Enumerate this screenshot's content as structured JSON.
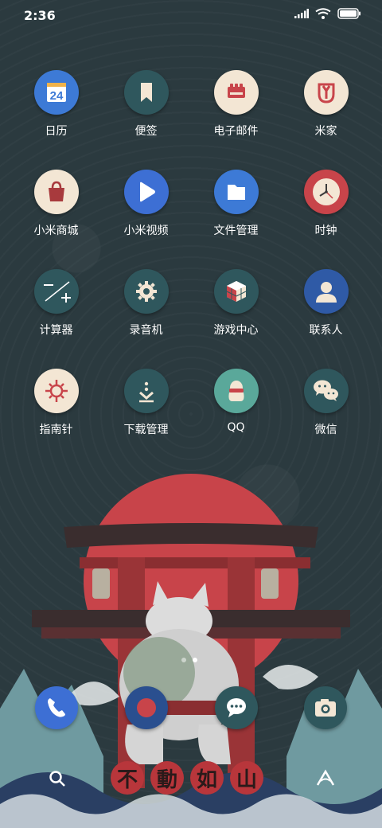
{
  "status_bar": {
    "time": "2:36"
  },
  "apps": [
    {
      "label": "日历",
      "icon": "calendar-icon",
      "badge_text": "24"
    },
    {
      "label": "便签",
      "icon": "bookmark-icon"
    },
    {
      "label": "电子邮件",
      "icon": "mail-icon"
    },
    {
      "label": "米家",
      "icon": "mijia-icon"
    },
    {
      "label": "小米商城",
      "icon": "shopping-bag-icon"
    },
    {
      "label": "小米视频",
      "icon": "video-play-icon"
    },
    {
      "label": "文件管理",
      "icon": "folder-icon"
    },
    {
      "label": "时钟",
      "icon": "clock-icon"
    },
    {
      "label": "计算器",
      "icon": "calculator-icon"
    },
    {
      "label": "录音机",
      "icon": "recorder-gear-icon"
    },
    {
      "label": "游戏中心",
      "icon": "game-cube-icon"
    },
    {
      "label": "联系人",
      "icon": "contact-person-icon"
    },
    {
      "label": "指南针",
      "icon": "compass-icon"
    },
    {
      "label": "下载管理",
      "icon": "download-icon"
    },
    {
      "label": "QQ",
      "icon": "qq-icon"
    },
    {
      "label": "微信",
      "icon": "wechat-icon"
    }
  ],
  "dock": [
    {
      "name": "phone",
      "icon": "phone-icon"
    },
    {
      "name": "browser",
      "icon": "browser-icon"
    },
    {
      "name": "messages",
      "icon": "message-icon"
    },
    {
      "name": "camera",
      "icon": "camera-icon"
    }
  ],
  "wallpaper": {
    "slogan": [
      "不",
      "動",
      "如",
      "山"
    ]
  },
  "colors": {
    "background": "#2b3a3f",
    "accent_red": "#c8444a",
    "icon_cream": "#f3e6d4",
    "icon_teal": "#2f575d",
    "icon_blue": "#3d6fd4"
  }
}
